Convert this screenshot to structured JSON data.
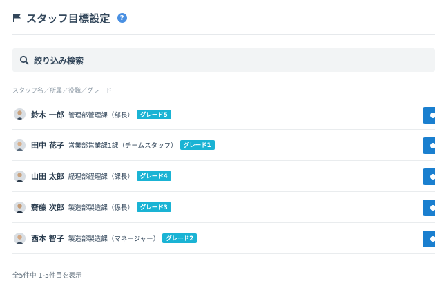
{
  "header": {
    "title": "スタッフ目標設定",
    "help_label": "?",
    "flag_icon": "flag-icon",
    "help_icon": "help-icon"
  },
  "search": {
    "label": "絞り込み検索",
    "icon": "search-icon"
  },
  "list": {
    "column_header": "スタッフ名／所属／役職／グレード",
    "rows": [
      {
        "name": "鈴木 一郎",
        "dept": "管理部管理課（部長）",
        "grade": "グレード5"
      },
      {
        "name": "田中 花子",
        "dept": "営業部営業課1課（チームスタッフ）",
        "grade": "グレード1"
      },
      {
        "name": "山田 太郎",
        "dept": "経理部経理課（課長）",
        "grade": "グレード4"
      },
      {
        "name": "齋藤 次郎",
        "dept": "製造部製造課（係長）",
        "grade": "グレード3"
      },
      {
        "name": "西本 智子",
        "dept": "製造部製造課（マネージャー）",
        "grade": "グレード2"
      }
    ]
  },
  "pagination": {
    "summary": "全5件中 1-5件目を表示"
  },
  "colors": {
    "accent": "#1a7fcf",
    "badge": "#1ab3d4",
    "help": "#4a90e2"
  }
}
